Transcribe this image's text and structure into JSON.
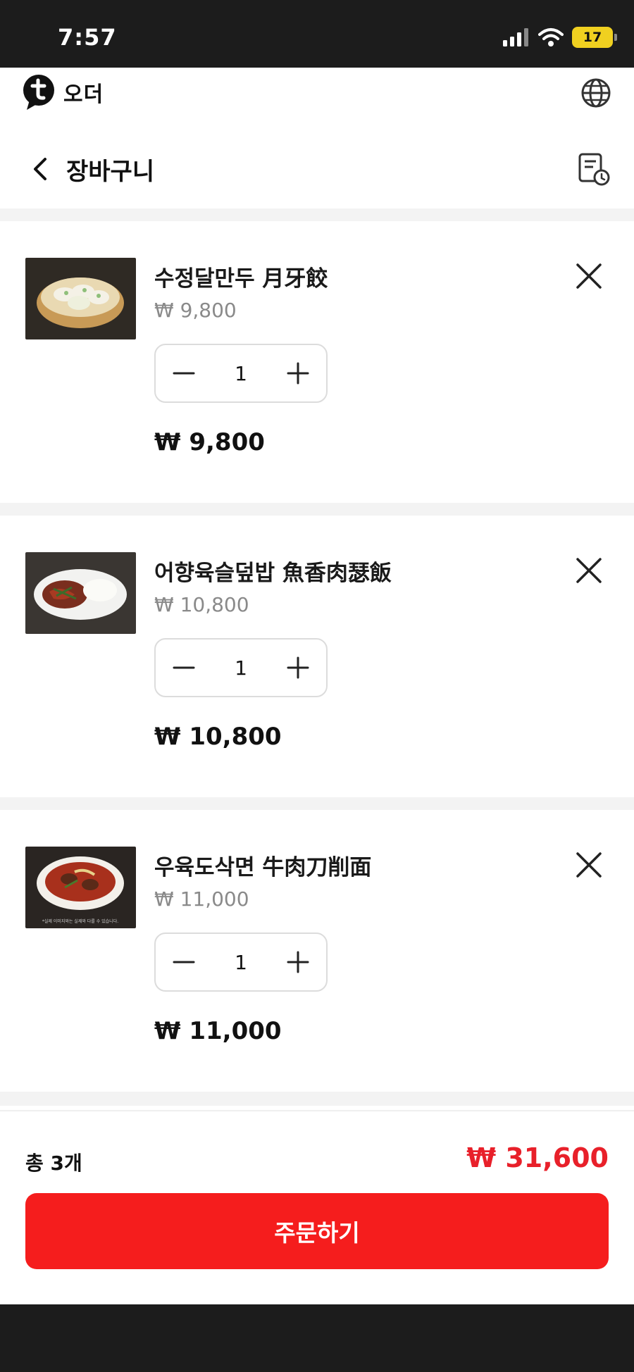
{
  "status": {
    "time": "7:57",
    "battery": "17"
  },
  "header": {
    "logo_text": "오더"
  },
  "page": {
    "title": "장바구니"
  },
  "cart": {
    "items": [
      {
        "name": "수정달만두 月牙餃",
        "unit_price": "₩ 9,800",
        "quantity": "1",
        "total": "₩ 9,800"
      },
      {
        "name": "어향육슬덮밥 魚香肉瑟飯",
        "unit_price": "₩ 10,800",
        "quantity": "1",
        "total": "₩ 10,800"
      },
      {
        "name": "우육도삭면 牛肉刀削面",
        "unit_price": "₩ 11,000",
        "quantity": "1",
        "total": "₩ 11,000"
      }
    ],
    "image_caption": "*실제 이미지와는 실제와 다를 수 있습니다."
  },
  "summary": {
    "count_label": "총 3개",
    "total_price": "₩ 31,600",
    "order_label": "주문하기"
  },
  "colors": {
    "accent": "#f51d1d",
    "price_red": "#e8202a",
    "status_bar": "#1c1c1c"
  }
}
